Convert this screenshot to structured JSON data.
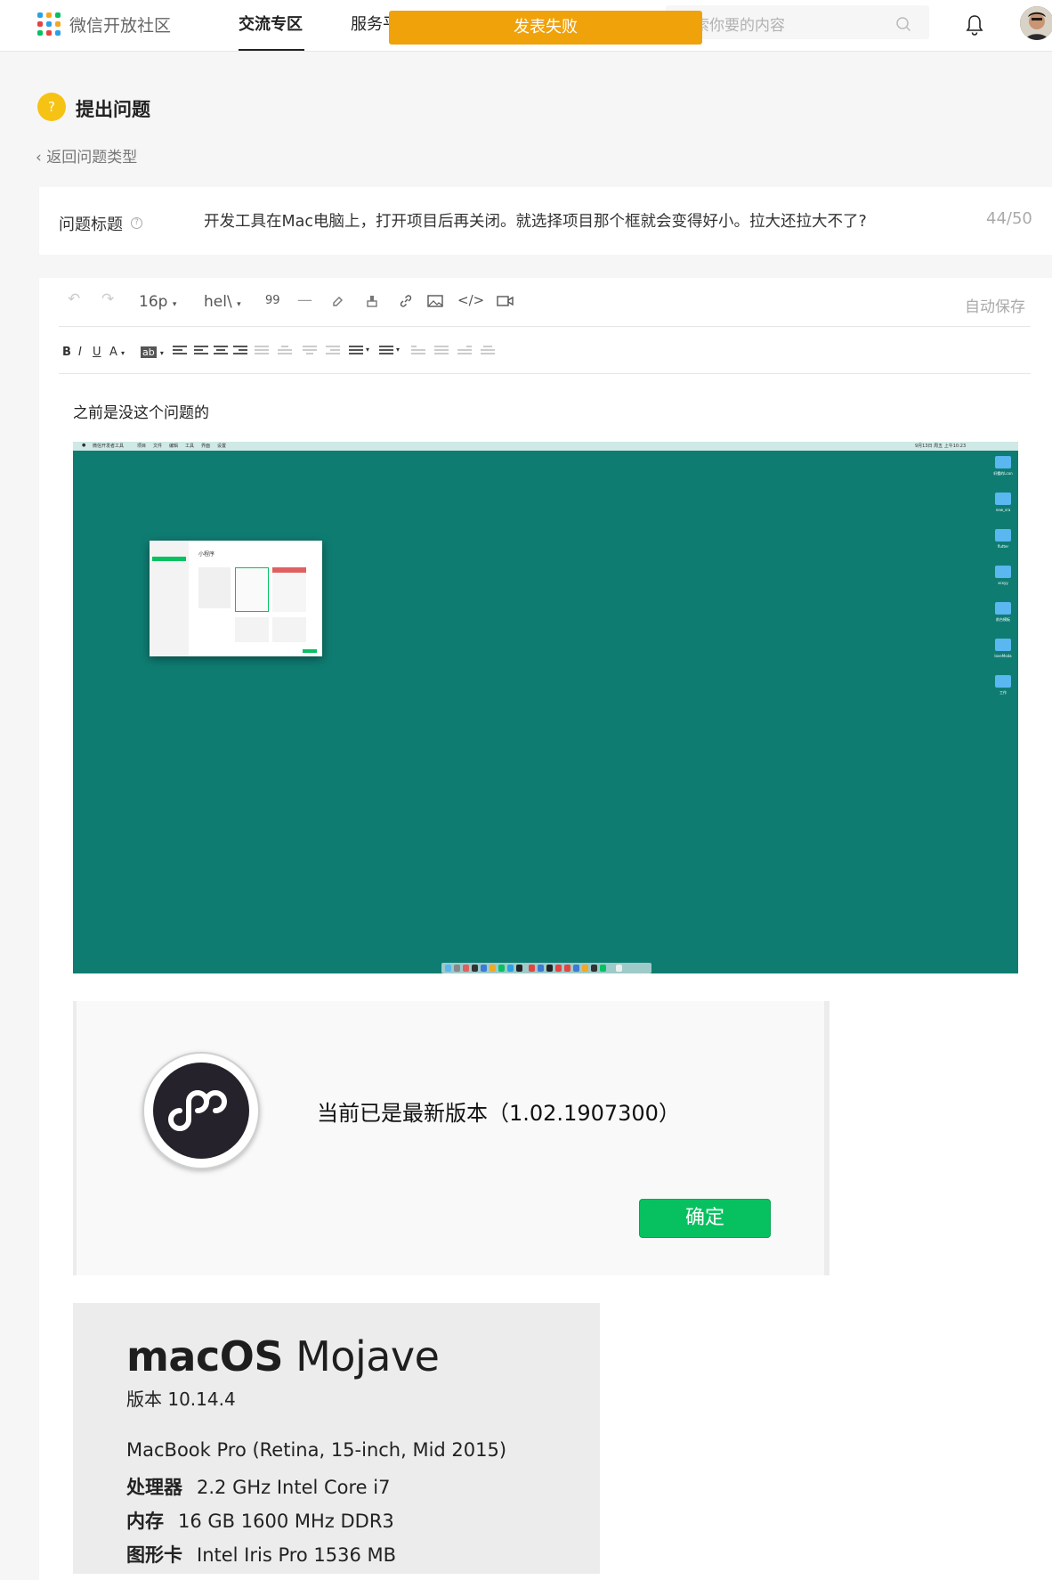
{
  "header": {
    "brand": "微信开放社区",
    "tabs": [
      {
        "label": "交流专区"
      },
      {
        "label": "服务平"
      }
    ],
    "search_placeholder": "索你要的内容",
    "toast": "发表失败"
  },
  "page": {
    "title": "提出问题",
    "title_icon": "?",
    "back": "返回问题类型"
  },
  "question": {
    "label": "问题标题",
    "value": "开发工具在Mac电脑上，打开项目后再关闭。就选择项目那个框就会变得好小。拉大还拉大不了?",
    "count": "44/50"
  },
  "editor": {
    "font_size": "16p",
    "font_family": "hel\\",
    "quote": "99",
    "hr": "—",
    "autosave": "自动保存",
    "format": {
      "bold": "B",
      "italic": "I",
      "underline": "U",
      "font_color": "A",
      "bg_color": "ab"
    },
    "body_text": "之前是没这个问题的"
  },
  "desktop": {
    "menu_items": [
      "微信开发者工具",
      "项目",
      "文件",
      "编辑",
      "工具",
      "界面",
      "设置"
    ],
    "status_text": "9月13日 周五 上午10:23",
    "folders": [
      "轩樱的Lcon",
      "new_sra",
      "flutter",
      "xcxyy",
      "前台模板",
      "loveModa",
      "工作"
    ],
    "mini_window_title": "小程序"
  },
  "dialog": {
    "message": "当前已是最新版本（1.02.1907300）",
    "ok": "确定"
  },
  "about": {
    "os_bold": "macOS",
    "os_name": "Mojave",
    "version": "版本 10.14.4",
    "model": "MacBook Pro (Retina, 15-inch, Mid 2015)",
    "specs": [
      {
        "label": "处理器",
        "value": "2.2 GHz Intel Core i7"
      },
      {
        "label": "内存",
        "value": "16 GB 1600 MHz DDR3"
      },
      {
        "label": "图形卡",
        "value": "Intel Iris Pro 1536 MB"
      }
    ]
  },
  "colors": {
    "accent_green": "#07c160",
    "toast": "#f0a20b",
    "desktop": "#0f7c72",
    "question_icon": "#f6c214"
  }
}
